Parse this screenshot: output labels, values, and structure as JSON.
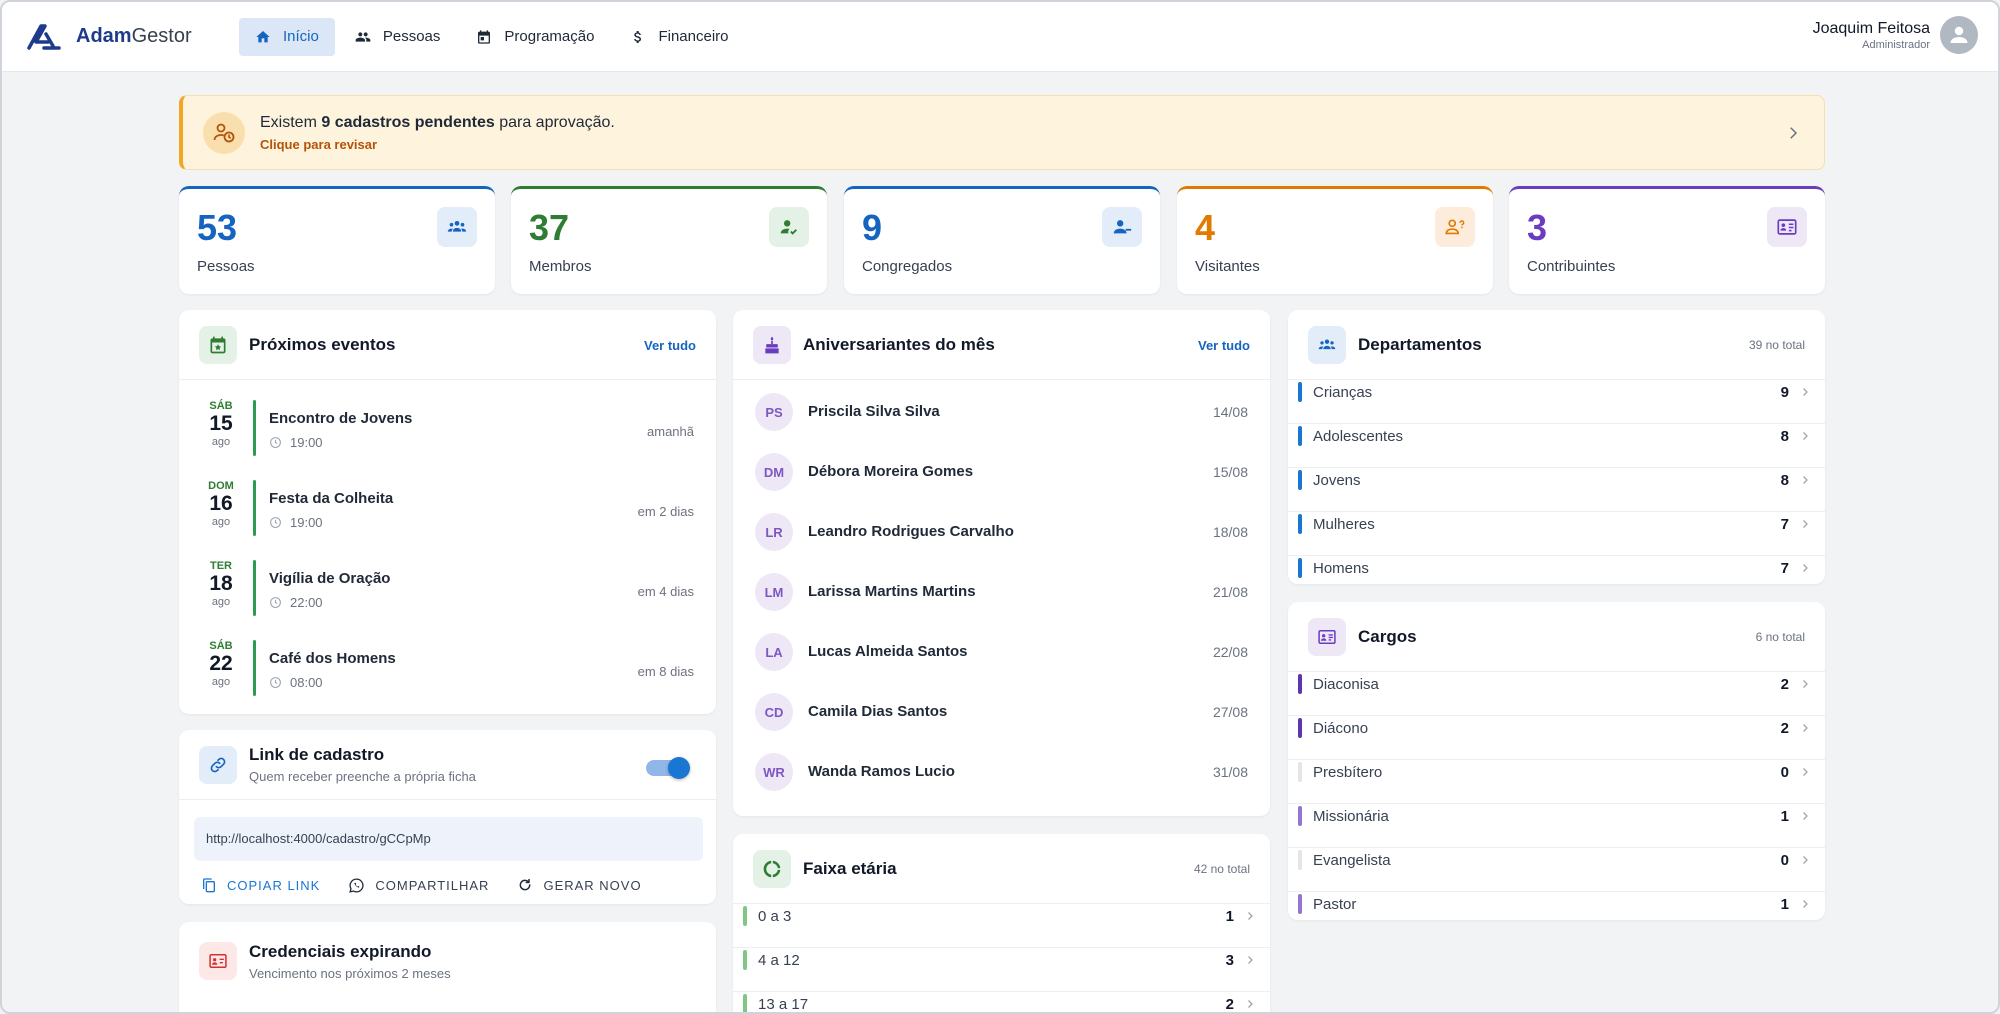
{
  "app": {
    "brand_bold": "Adam",
    "brand_light": "Gestor"
  },
  "nav": [
    {
      "label": "Início",
      "icon": "home-icon",
      "active": true
    },
    {
      "label": "Pessoas",
      "icon": "people-icon",
      "active": false
    },
    {
      "label": "Programação",
      "icon": "calendar-icon",
      "active": false
    },
    {
      "label": "Financeiro",
      "icon": "dollar-icon",
      "active": false
    }
  ],
  "user": {
    "name": "Joaquim Feitosa",
    "role": "Administrador"
  },
  "alert": {
    "prefix": "Existem ",
    "bold": "9 cadastros pendentes",
    "suffix": " para aprovação.",
    "link": "Clique para revisar"
  },
  "stats": [
    {
      "value": "53",
      "label": "Pessoas",
      "color": "#1565c0"
    },
    {
      "value": "37",
      "label": "Membros",
      "color": "#2e7d32"
    },
    {
      "value": "9",
      "label": "Congregados",
      "color": "#1565c0"
    },
    {
      "value": "4",
      "label": "Visitantes",
      "color": "#e07b00"
    },
    {
      "value": "3",
      "label": "Contribuintes",
      "color": "#6a3cc0"
    }
  ],
  "events": {
    "title": "Próximos eventos",
    "link": "Ver tudo",
    "items": [
      {
        "dow": "SÁB",
        "day": "15",
        "month": "ago",
        "title": "Encontro de Jovens",
        "time": "19:00",
        "relative": "amanhã"
      },
      {
        "dow": "DOM",
        "day": "16",
        "month": "ago",
        "title": "Festa da Colheita",
        "time": "19:00",
        "relative": "em 2 dias"
      },
      {
        "dow": "TER",
        "day": "18",
        "month": "ago",
        "title": "Vigília de Oração",
        "time": "22:00",
        "relative": "em 4 dias"
      },
      {
        "dow": "SÁB",
        "day": "22",
        "month": "ago",
        "title": "Café dos Homens",
        "time": "08:00",
        "relative": "em 8 dias"
      }
    ]
  },
  "birthdays": {
    "title": "Aniversariantes do mês",
    "link": "Ver tudo",
    "items": [
      {
        "initials": "PS",
        "name": "Priscila Silva Silva",
        "date": "14/08"
      },
      {
        "initials": "DM",
        "name": "Débora Moreira Gomes",
        "date": "15/08"
      },
      {
        "initials": "LR",
        "name": "Leandro Rodrigues Carvalho",
        "date": "18/08"
      },
      {
        "initials": "LM",
        "name": "Larissa Martins Martins",
        "date": "21/08"
      },
      {
        "initials": "LA",
        "name": "Lucas Almeida Santos",
        "date": "22/08"
      },
      {
        "initials": "CD",
        "name": "Camila Dias Santos",
        "date": "27/08"
      },
      {
        "initials": "WR",
        "name": "Wanda Ramos Lucio",
        "date": "31/08"
      }
    ]
  },
  "departments": {
    "title": "Departamentos",
    "total": "39 no total",
    "items": [
      {
        "label": "Crianças",
        "count": "9",
        "color": "#1976d2"
      },
      {
        "label": "Adolescentes",
        "count": "8",
        "color": "#1976d2"
      },
      {
        "label": "Jovens",
        "count": "8",
        "color": "#1976d2"
      },
      {
        "label": "Mulheres",
        "count": "7",
        "color": "#1976d2"
      },
      {
        "label": "Homens",
        "count": "7",
        "color": "#1976d2"
      }
    ]
  },
  "roles": {
    "title": "Cargos",
    "total": "6 no total",
    "items": [
      {
        "label": "Diaconisa",
        "count": "2",
        "color": "#5e35b1"
      },
      {
        "label": "Diácono",
        "count": "2",
        "color": "#5e35b1"
      },
      {
        "label": "Presbítero",
        "count": "0",
        "color": "#e3e5e8"
      },
      {
        "label": "Missionária",
        "count": "1",
        "color": "#9575cd"
      },
      {
        "label": "Evangelista",
        "count": "0",
        "color": "#e3e5e8"
      },
      {
        "label": "Pastor",
        "count": "1",
        "color": "#9575cd"
      }
    ]
  },
  "signup_link": {
    "title": "Link de cadastro",
    "subtitle": "Quem receber preenche a própria ficha",
    "enabled": true,
    "url": "http://localhost:4000/cadastro/gCCpMp",
    "copy": "COPIAR LINK",
    "share": "COMPARTILHAR",
    "regenerate": "GERAR NOVO"
  },
  "age_ranges": {
    "title": "Faixa etária",
    "total": "42 no total",
    "items": [
      {
        "label": "0 a 3",
        "count": "1",
        "color": "#81c784"
      },
      {
        "label": "4 a 12",
        "count": "3",
        "color": "#81c784"
      },
      {
        "label": "13 a 17",
        "count": "2",
        "color": "#81c784"
      }
    ]
  },
  "credentials": {
    "title": "Credenciais expirando",
    "subtitle": "Vencimento nos próximos 2 meses"
  }
}
